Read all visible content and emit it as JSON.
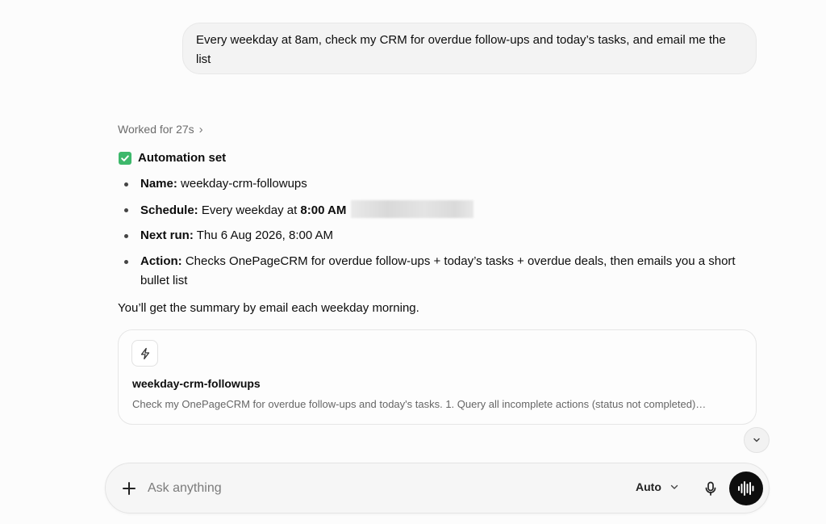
{
  "user_message": {
    "text": "Every weekday at 8am, check my CRM for overdue follow-ups and today’s tasks, and email me the list"
  },
  "assistant": {
    "worked_for": "Worked for 27s",
    "heading": "Automation set",
    "bullets": [
      {
        "label": "Name:",
        "value": "weekday-crm-followups"
      },
      {
        "label": "Schedule:",
        "value_prefix": "Every weekday at",
        "value_bold": "8:00 AM",
        "redacted": true
      },
      {
        "label": "Next run:",
        "value": "Thu 6 Aug 2026, 8:00 AM"
      },
      {
        "label": "Action:",
        "value": "Checks OnePageCRM for overdue follow-ups + today’s tasks + overdue deals, then emails you a short bullet list"
      }
    ],
    "summary": "You’ll get the summary by email each weekday morning."
  },
  "automation_card": {
    "icon": "bolt-icon",
    "title": "weekday-crm-followups",
    "description": "Check my OnePageCRM for overdue follow-ups and today's tasks. 1. Query all incomplete actions (status not completed)…"
  },
  "composer": {
    "placeholder": "Ask anything",
    "model_label": "Auto"
  },
  "colors": {
    "check_green": "#3db86b",
    "voice_button": "#0d0d0d",
    "bubble_bg": "#f3f3f3"
  }
}
